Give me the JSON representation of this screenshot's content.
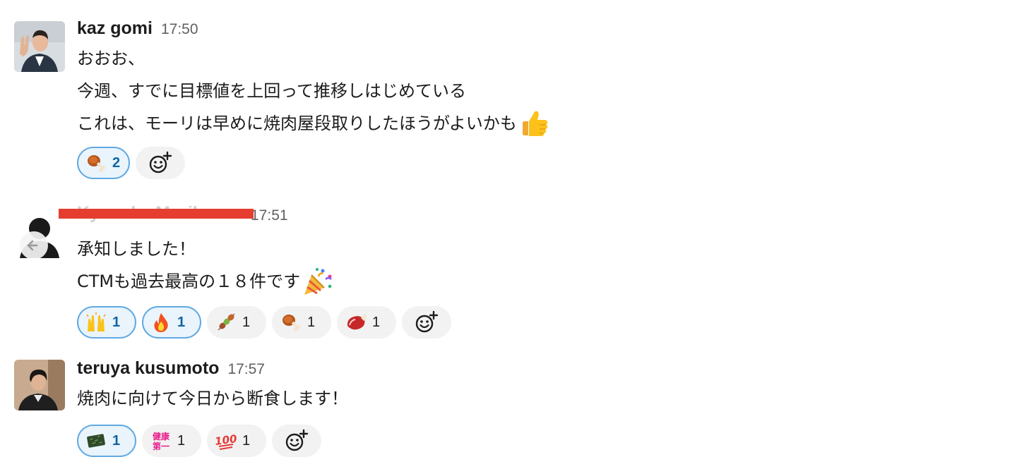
{
  "messages": [
    {
      "sender": "kaz gomi",
      "time": "17:50",
      "lines": [
        "おおお、",
        "今週、すでに目標値を上回って推移しはじめている",
        "これは、モーリは早めに焼肉屋段取りしたほうがよいかも"
      ],
      "inline_emoji": "thumbs-up",
      "reactions": [
        {
          "emoji": "meat-on-bone",
          "count": "2",
          "mine": true
        }
      ]
    },
    {
      "sender": "Kyosuke Morikawa",
      "time": "17:51",
      "lines": [
        "承知しました！",
        "CTMも過去最高の１８件です"
      ],
      "inline_emoji": "party-popper",
      "reactions": [
        {
          "emoji": "raised-hands",
          "count": "1",
          "mine": true
        },
        {
          "emoji": "fire",
          "count": "1",
          "mine": true
        },
        {
          "emoji": "skewer",
          "count": "1",
          "mine": false
        },
        {
          "emoji": "meat-on-bone",
          "count": "1",
          "mine": false
        },
        {
          "emoji": "cut-of-meat",
          "count": "1",
          "mine": false
        }
      ]
    },
    {
      "sender": "teruya kusumoto",
      "time": "17:57",
      "lines": [
        "焼肉に向けて今日から断食します！"
      ],
      "reactions": [
        {
          "emoji": "nori-sheet",
          "count": "1",
          "mine": true
        },
        {
          "emoji": "kenko-daiichi",
          "label": "健康\n第一",
          "count": "1",
          "mine": false
        },
        {
          "emoji": "hundred-points",
          "label": "100",
          "count": "1",
          "mine": false
        }
      ]
    }
  ],
  "colors": {
    "accent_blue": "#1264a3",
    "reaction_mine_border": "#61a9e1",
    "reaction_mine_bg": "#e9f4fc",
    "reaction_bg": "#f2f2f2",
    "redaction": "#e53d2f"
  }
}
